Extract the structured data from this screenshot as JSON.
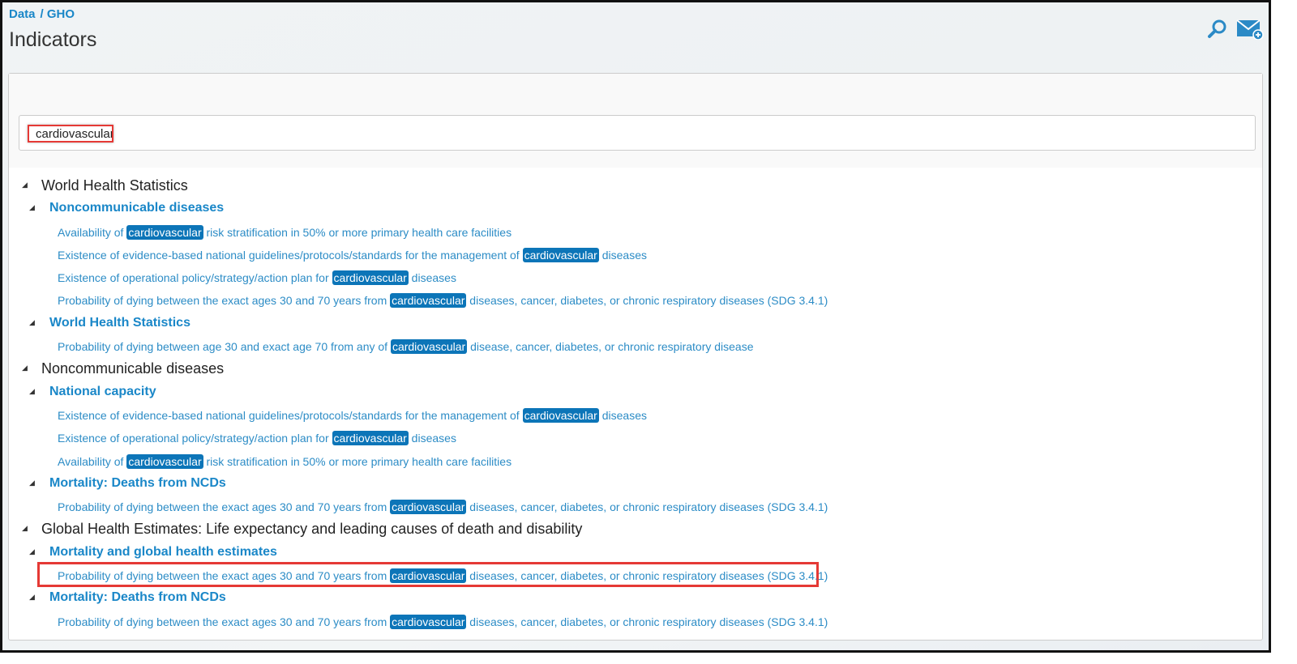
{
  "breadcrumb": [
    "Data",
    "/ GHO"
  ],
  "title": "Indicators",
  "search": {
    "value": "cardiovascular"
  },
  "tree": [
    {
      "label": "World Health Statistics",
      "groups": [
        {
          "label": "Noncommunicable diseases",
          "items": [
            {
              "before": "Availability of ",
              "hl": "cardiovascular",
              "after": " risk stratification in 50% or more primary health care facilities"
            },
            {
              "before": "Existence of evidence-based national guidelines/protocols/standards for the management of ",
              "hl": "cardiovascular",
              "after": " diseases"
            },
            {
              "before": "Existence of operational policy/strategy/action plan for ",
              "hl": "cardiovascular",
              "after": " diseases"
            },
            {
              "before": "Probability of dying between the exact ages 30 and 70 years from ",
              "hl": "cardiovascular",
              "after": " diseases, cancer, diabetes, or chronic respiratory diseases (SDG 3.4.1)"
            }
          ]
        },
        {
          "label": "World Health Statistics",
          "items": [
            {
              "before": "Probability of dying between age 30 and exact age 70 from any of ",
              "hl": "cardiovascular",
              "after": " disease, cancer, diabetes, or chronic respiratory disease"
            }
          ]
        }
      ]
    },
    {
      "label": "Noncommunicable diseases",
      "groups": [
        {
          "label": "National capacity",
          "items": [
            {
              "before": "Existence of evidence-based national guidelines/protocols/standards for the management of ",
              "hl": "cardiovascular",
              "after": " diseases"
            },
            {
              "before": "Existence of operational policy/strategy/action plan for ",
              "hl": "cardiovascular",
              "after": " diseases"
            },
            {
              "before": "Availability of ",
              "hl": "cardiovascular",
              "after": " risk stratification in 50% or more primary health care facilities"
            }
          ]
        },
        {
          "label": "Mortality: Deaths from NCDs",
          "items": [
            {
              "before": "Probability of dying between the exact ages 30 and 70 years from ",
              "hl": "cardiovascular",
              "after": " diseases, cancer, diabetes, or chronic respiratory diseases (SDG 3.4.1)"
            }
          ]
        }
      ]
    },
    {
      "label": "Global Health Estimates: Life expectancy and leading causes of death and disability",
      "groups": [
        {
          "label": "Mortality and global health estimates",
          "items": [
            {
              "before": "Probability of dying between the exact ages 30 and 70 years from ",
              "hl": "cardiovascular",
              "after": " diseases, cancer, diabetes, or chronic respiratory diseases (SDG 3.4.1)",
              "selected": true
            }
          ]
        },
        {
          "label": "Mortality: Deaths from NCDs",
          "items": [
            {
              "before": "Probability of dying between the exact ages 30 and 70 years from ",
              "hl": "cardiovascular",
              "after": " diseases, cancer, diabetes, or chronic respiratory diseases (SDG 3.4.1)"
            }
          ]
        }
      ]
    }
  ]
}
